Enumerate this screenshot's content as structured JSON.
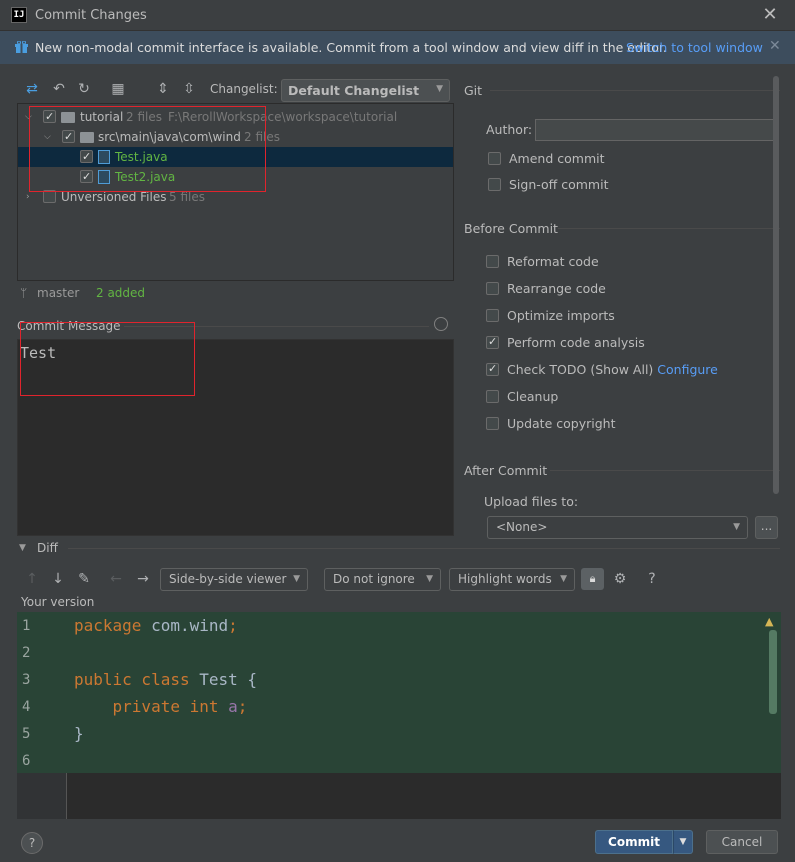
{
  "window": {
    "title": "Commit Changes",
    "logo": "IJ"
  },
  "banner": {
    "text": "New non-modal commit interface is available. Commit from a tool window and view diff in the editor.",
    "link": "Switch to tool window"
  },
  "toolbar": {
    "changelist_label": "Changelist:",
    "changelist_value": "Default Changelist"
  },
  "tree": {
    "root": {
      "name": "tutorial",
      "count": "2 files",
      "path": "F:\\RerollWorkspace\\workspace\\tutorial"
    },
    "folder": {
      "name": "src\\main\\java\\com\\wind",
      "count": "2 files"
    },
    "files": [
      "Test.java",
      "Test2.java"
    ],
    "unversioned": {
      "name": "Unversioned Files",
      "count": "5 files"
    }
  },
  "branch": {
    "name": "master",
    "status": "2 added"
  },
  "commit_message": {
    "label": "Commit Message",
    "value": "Test"
  },
  "git": {
    "title": "Git",
    "author_label": "Author:",
    "author_value": "",
    "amend": "Amend commit",
    "signoff": "Sign-off commit"
  },
  "before_commit": {
    "title": "Before Commit",
    "reformat": "Reformat code",
    "rearrange": "Rearrange code",
    "optimize": "Optimize imports",
    "analysis": "Perform code analysis",
    "todo": "Check TODO (Show All)",
    "todo_link": "Configure",
    "cleanup": "Cleanup",
    "copyright": "Update copyright"
  },
  "after_commit": {
    "title": "After Commit",
    "upload_label": "Upload files to:",
    "upload_value": "<None>",
    "more": "..."
  },
  "diff": {
    "title": "Diff",
    "viewer": "Side-by-side viewer",
    "ignore": "Do not ignore",
    "highlight": "Highlight words",
    "your_version": "Your version",
    "line_numbers": [
      "1",
      "2",
      "3",
      "4",
      "5",
      "6"
    ]
  },
  "footer": {
    "help": "?",
    "commit": "Commit",
    "cancel": "Cancel"
  }
}
